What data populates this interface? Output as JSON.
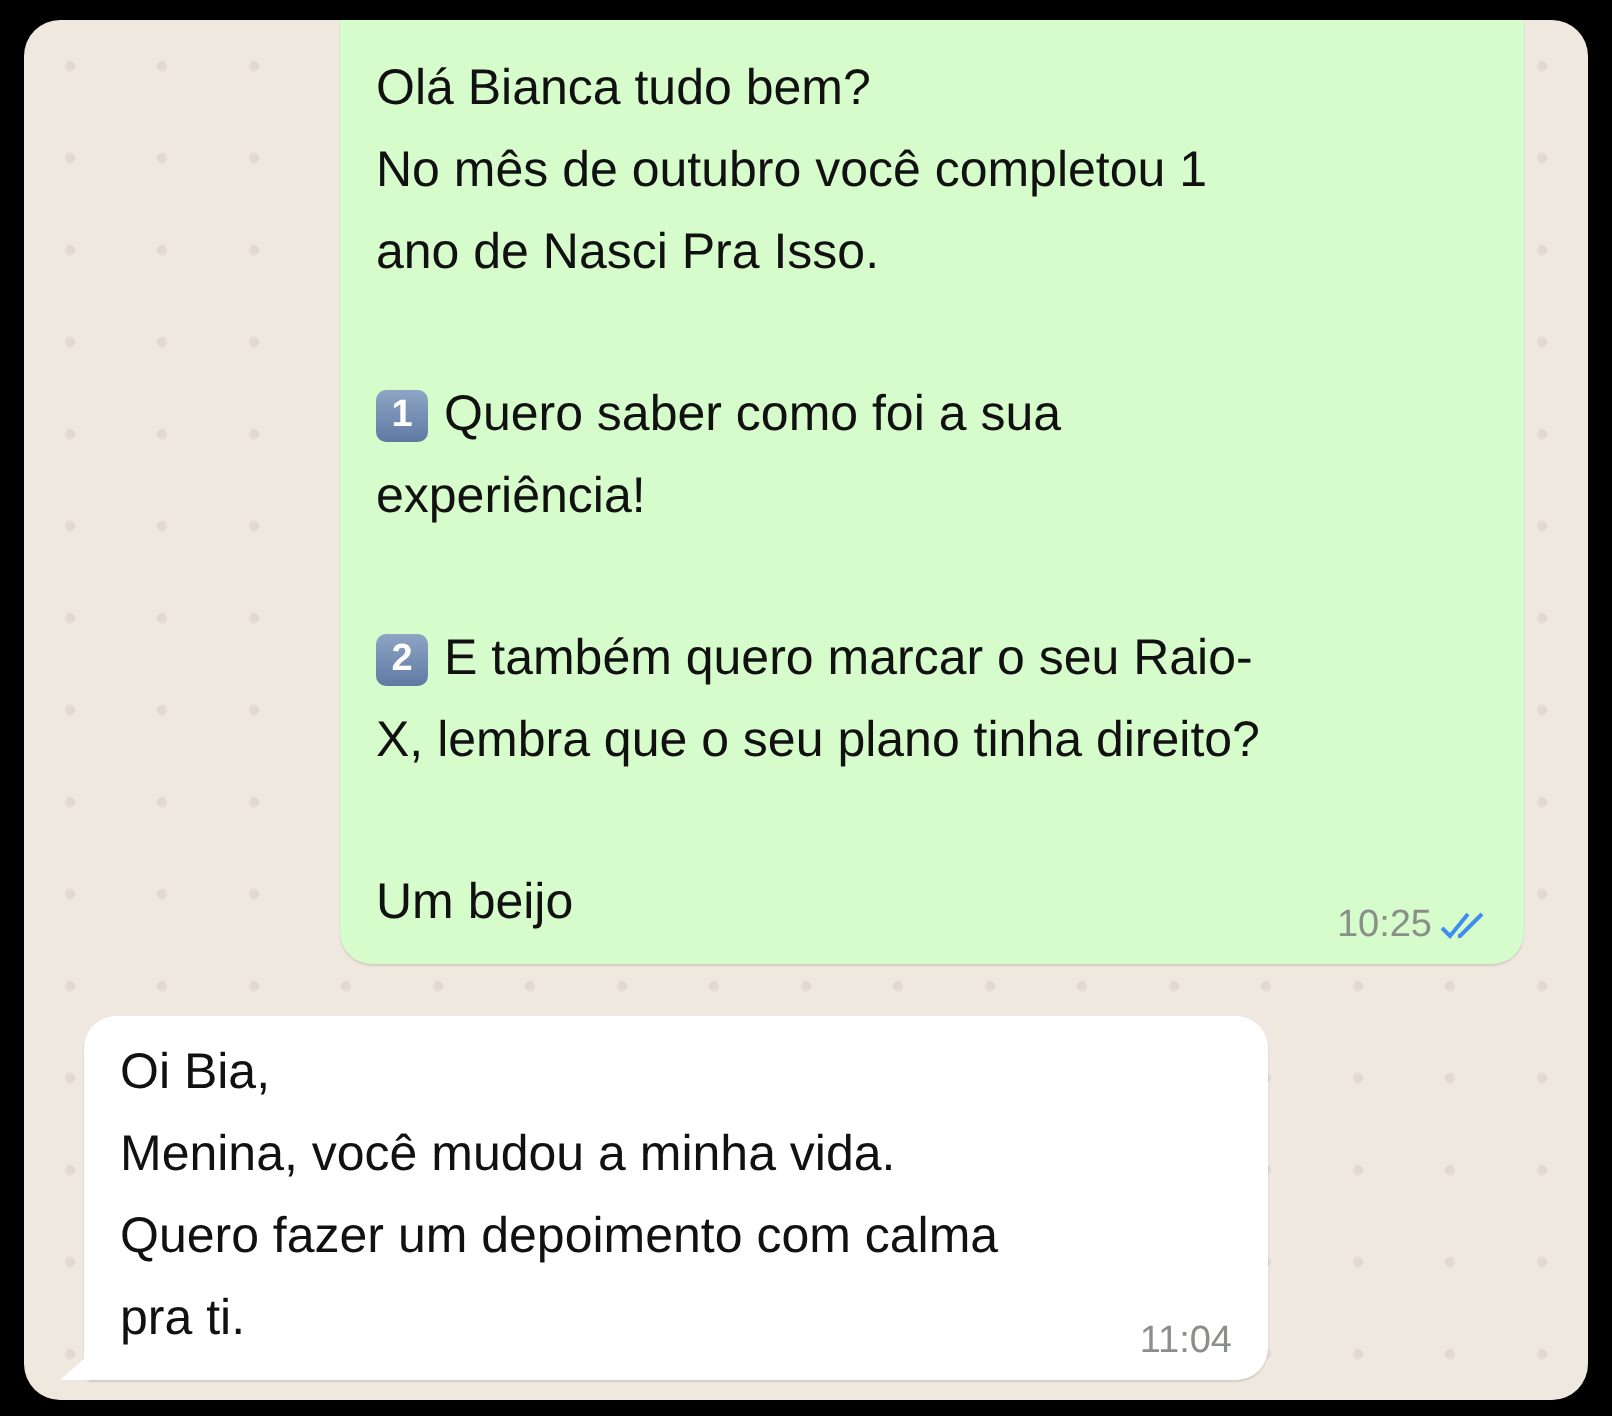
{
  "messages": [
    {
      "kind": "outgoing",
      "time": "10:25",
      "read": true,
      "paragraphs": [
        {
          "lines": [
            "Olá Bianca tudo bem?",
            "No mês de outubro você completou 1",
            "ano de Nasci Pra Isso."
          ]
        },
        {
          "keycap": "1",
          "lines": [
            "Quero saber como foi a sua",
            "experiência!"
          ]
        },
        {
          "keycap": "2",
          "lines": [
            "E também quero marcar o seu Raio-",
            "X, lembra que o seu plano tinha direito?"
          ]
        },
        {
          "lines": [
            "Um beijo"
          ]
        }
      ]
    },
    {
      "kind": "incoming",
      "time": "11:04",
      "paragraphs": [
        {
          "lines": [
            "Oi Bia,",
            "Menina, você mudou a minha vida.",
            "Quero fazer um depoimento com calma",
            "pra ti."
          ]
        }
      ]
    }
  ]
}
